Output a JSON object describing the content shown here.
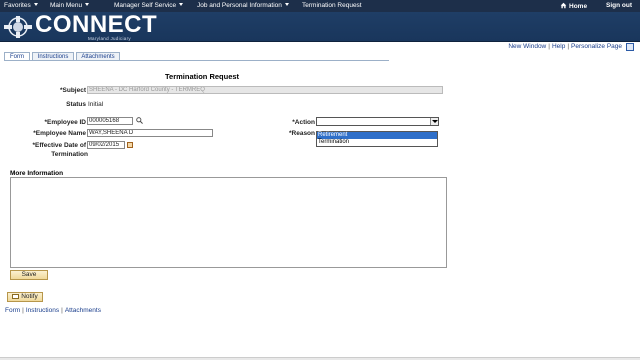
{
  "topnav": {
    "favorites": "Favorites",
    "main_menu": "Main Menu",
    "breadcrumb_1": "Manager Self Service",
    "breadcrumb_2": "Job and Personal Information",
    "breadcrumb_3": "Termination Request",
    "home": "Home",
    "sign_out": "Sign out"
  },
  "banner": {
    "title": "CONNECT",
    "subtitle": "Maryland Judiciary"
  },
  "util_links": {
    "new_window": "New Window",
    "help": "Help",
    "personalize": "Personalize Page"
  },
  "tabs": [
    "Form",
    "Instructions",
    "Attachments"
  ],
  "form": {
    "title": "Termination Request",
    "subject_label": "*Subject",
    "subject_value": "SHEENA - DC Harford County - TERMREQ",
    "status_label": "Status",
    "status_value": "Initial",
    "employee_id_label": "*Employee ID",
    "employee_id_value": "000005168",
    "employee_name_label": "*Employee Name",
    "employee_name_value": "WAY,SHEENA D",
    "effective_date_label_1": "*Effective Date of",
    "effective_date_label_2": "Termination",
    "effective_date_value": "09/02/2015",
    "action_label": "*Action",
    "action_value": "",
    "reason_label": "*Reason",
    "action_options": [
      "Retirement",
      "Termination"
    ],
    "more_info_label": "More Information",
    "more_info_value": ""
  },
  "buttons": {
    "save": "Save",
    "notify": "Notify"
  },
  "footer_links": {
    "form": "Form",
    "instructions": "Instructions",
    "attachments": "Attachments"
  },
  "colors": {
    "nav_bg": "#1d2f4a",
    "banner_bg": "#1f3e66",
    "link": "#1a3e8c",
    "selected_option": "#2f6fc9",
    "button_bg": "#f0d89a"
  }
}
